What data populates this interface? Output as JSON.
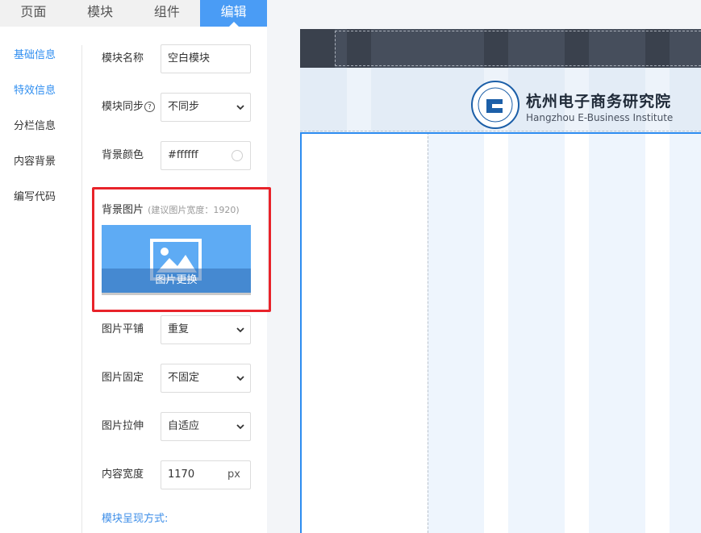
{
  "tabs": [
    {
      "label": "页面",
      "active": false
    },
    {
      "label": "模块",
      "active": false
    },
    {
      "label": "组件",
      "active": false
    },
    {
      "label": "编辑",
      "active": true
    }
  ],
  "sidenav": [
    {
      "label": "基础信息",
      "active": true
    },
    {
      "label": "特效信息",
      "active": true
    },
    {
      "label": "分栏信息",
      "active": false
    },
    {
      "label": "内容背景",
      "active": false
    },
    {
      "label": "编写代码",
      "active": false
    }
  ],
  "form": {
    "module_name": {
      "label": "模块名称",
      "value": "空白模块"
    },
    "module_sync": {
      "label": "模块同步",
      "help": "?",
      "value": "不同步"
    },
    "bg_color": {
      "label": "背景颜色",
      "value": "#ffffff"
    },
    "bg_image": {
      "label": "背景图片",
      "hint": "(建议图片宽度：1920)",
      "button": "图片更换"
    },
    "image_tile": {
      "label": "图片平铺",
      "value": "重复"
    },
    "image_fixed": {
      "label": "图片固定",
      "value": "不固定"
    },
    "image_stretch": {
      "label": "图片拉伸",
      "value": "自适应"
    },
    "content_width": {
      "label": "内容宽度",
      "value": "1170",
      "unit": "px"
    },
    "display_mode_title": "模块呈现方式:"
  },
  "preview": {
    "brand_title": "杭州电子商务研究院",
    "brand_subtitle": "Hangzhou E-Business Institute"
  },
  "colors": {
    "accent": "#4a9cf5",
    "highlight": "#e8232a",
    "nav_dark": "#464e5c"
  },
  "icons": [
    "chevron-down-icon",
    "help-icon",
    "color-swatch-icon",
    "image-icon",
    "logo-icon"
  ]
}
